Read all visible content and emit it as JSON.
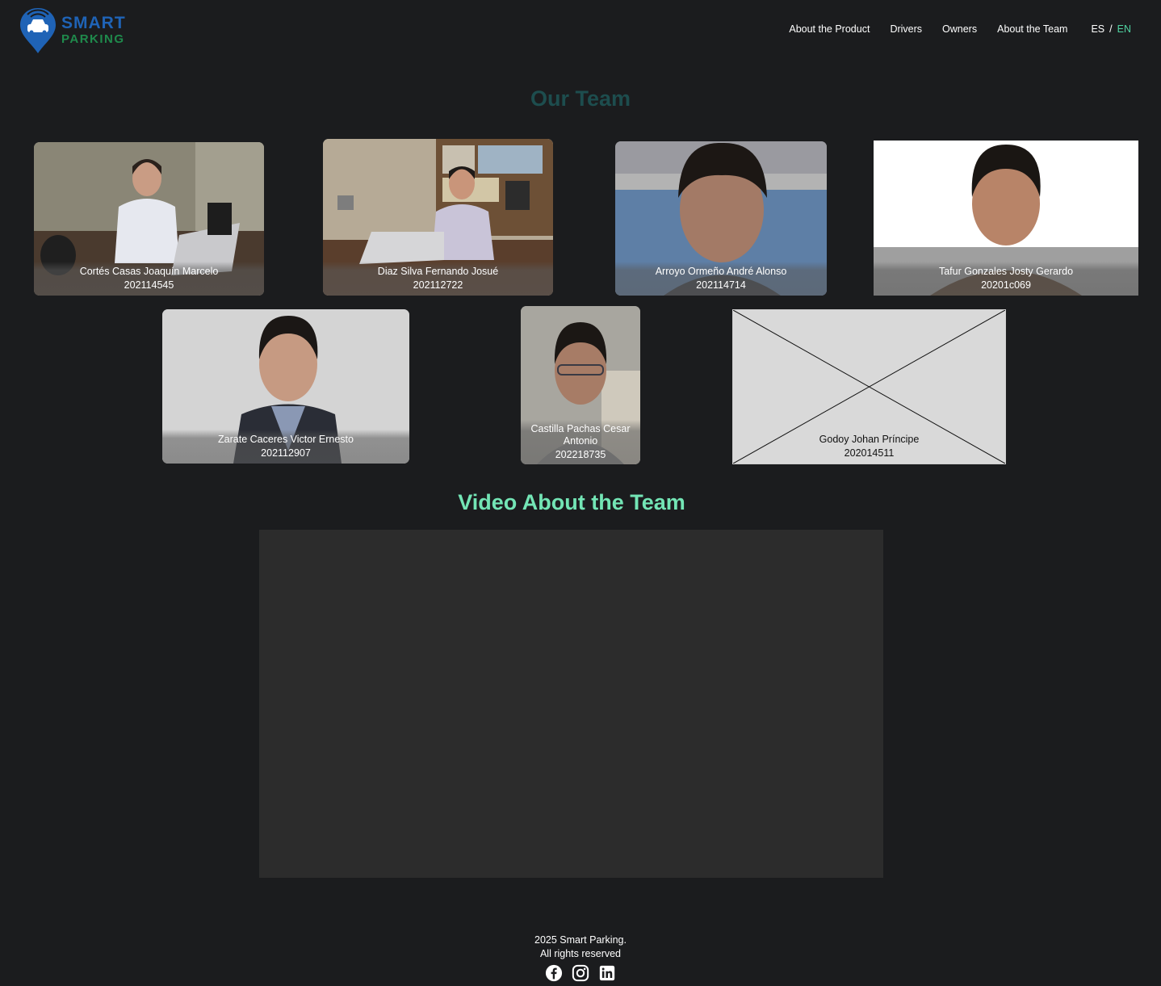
{
  "brand": {
    "word1": "SMART",
    "word2": "PARKING",
    "primary_color": "#1f63b6",
    "secondary_color": "#1f8a4c"
  },
  "nav": {
    "items": [
      {
        "label": "About the Product"
      },
      {
        "label": "Drivers"
      },
      {
        "label": "Owners"
      },
      {
        "label": "About the Team"
      }
    ],
    "lang_es": "ES",
    "lang_sep": "/",
    "lang_en": "EN",
    "active_lang_color": "#4fd3a1"
  },
  "team": {
    "title": "Our Team",
    "members": [
      {
        "name": "Cortés Casas Joaquín Marcelo",
        "code": "202114545"
      },
      {
        "name": "Diaz Silva Fernando Josué",
        "code": "202112722"
      },
      {
        "name": "Arroyo Ormeño André Alonso",
        "code": "202114714"
      },
      {
        "name": "Tafur Gonzales Josty Gerardo",
        "code": "20201c069"
      },
      {
        "name": "Zarate Caceres Victor Ernesto",
        "code": "202112907"
      },
      {
        "name": "Castilla Pachas Cesar Antonio",
        "code": "202218735"
      },
      {
        "name": "Godoy Johan Príncipe",
        "code": "202014511"
      }
    ]
  },
  "video": {
    "title": "Video About the Team"
  },
  "footer": {
    "line1": "2025 Smart Parking.",
    "line2": "All rights reserved",
    "socials": [
      "facebook-icon",
      "instagram-icon",
      "linkedin-icon"
    ]
  }
}
